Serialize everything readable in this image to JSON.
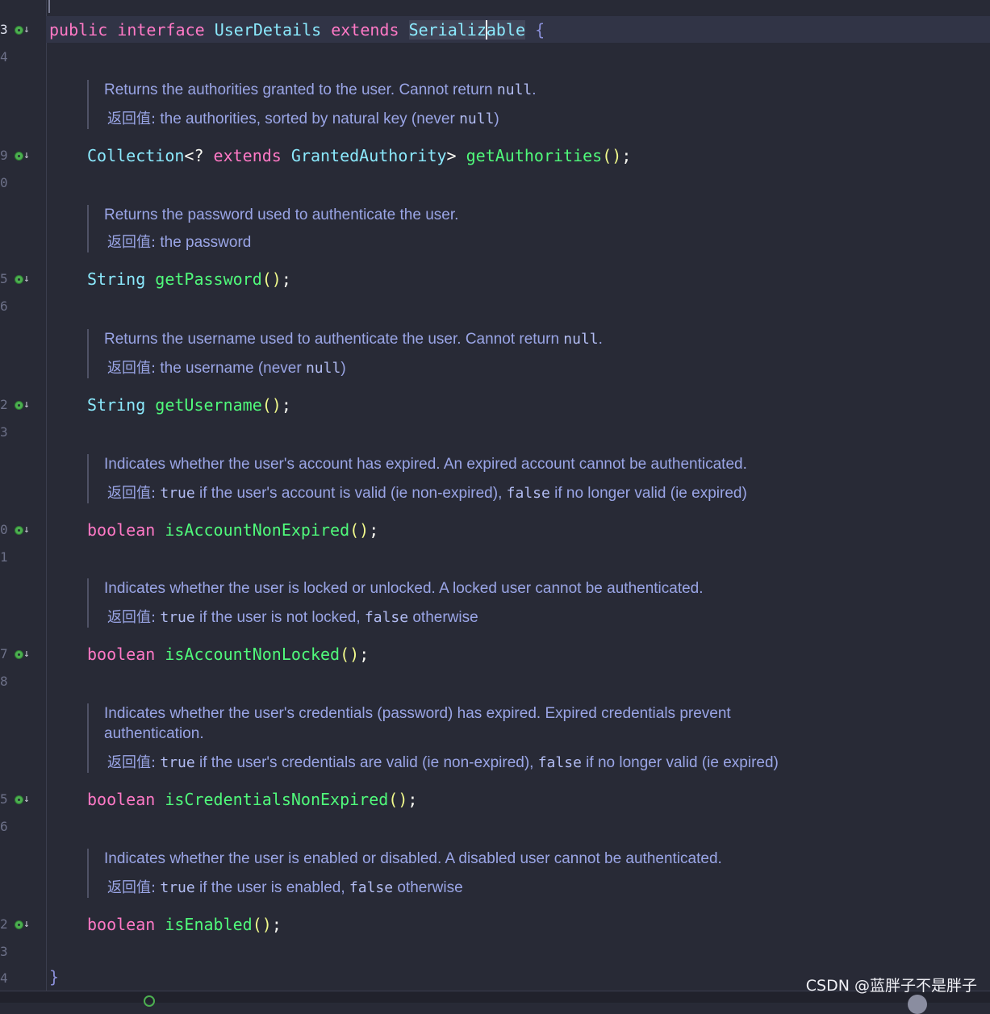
{
  "editor": {
    "header_line": {
      "kw1": "public",
      "kw2": "interface",
      "name": "UserDetails",
      "kw3": "extends",
      "super_a": "Serializ",
      "super_b": "able",
      "brace": "{"
    },
    "closing_brace": "}",
    "line_numbers": {
      "l3": "3",
      "l4": "4",
      "l9": "9",
      "l0": "0",
      "l5": "5",
      "l6": "6",
      "l2": "2",
      "l3b": "3",
      "l0b": "0",
      "l1": "1",
      "l7": "7",
      "l8": "8",
      "l5b": "5",
      "l6b": "6",
      "l2b": "2",
      "l3c": "3",
      "l4b": "4"
    },
    "return_label": "返回值:",
    "null_kw": "null",
    "true_kw": "true",
    "false_kw": "false",
    "methods": [
      {
        "doc_desc_a": "Returns the authorities granted to the user. Cannot return ",
        "doc_desc_b": ".",
        "doc_ret_a": "the authorities, sorted by natural key (never ",
        "doc_ret_b": ")",
        "type_a": "Collection",
        "type_b": "<? ",
        "type_kw": "extends",
        "type_c": "GrantedAuthority",
        "type_d": ">",
        "name": "getAuthorities",
        "parens": "()",
        "semi": ";"
      },
      {
        "doc_desc": "Returns the password used to authenticate the user.",
        "doc_ret": "the password",
        "type": "String",
        "name": "getPassword",
        "parens": "()",
        "semi": ";"
      },
      {
        "doc_desc_a": "Returns the username used to authenticate the user. Cannot return ",
        "doc_desc_b": ".",
        "doc_ret_a": "the username (never ",
        "doc_ret_b": ")",
        "type": "String",
        "name": "getUsername",
        "parens": "()",
        "semi": ";"
      },
      {
        "doc_desc": "Indicates whether the user's account has expired. An expired account cannot be authenticated.",
        "doc_ret_a": " if the user's account is valid (ie non-expired), ",
        "doc_ret_b": " if no longer valid (ie expired)",
        "type": "boolean",
        "name": "isAccountNonExpired",
        "parens": "()",
        "semi": ";"
      },
      {
        "doc_desc": "Indicates whether the user is locked or unlocked. A locked user cannot be authenticated.",
        "doc_ret_a": " if the user is not locked, ",
        "doc_ret_b": " otherwise",
        "type": "boolean",
        "name": "isAccountNonLocked",
        "parens": "()",
        "semi": ";"
      },
      {
        "doc_desc": "Indicates whether the user's credentials (password) has expired. Expired credentials prevent authentication.",
        "doc_ret_a": " if the user's credentials are valid (ie non-expired), ",
        "doc_ret_b": " if no longer valid (ie expired)",
        "type": "boolean",
        "name": "isCredentialsNonExpired",
        "parens": "()",
        "semi": ";"
      },
      {
        "doc_desc": "Indicates whether the user is enabled or disabled. A disabled user cannot be authenticated.",
        "doc_ret_a": " if the user is enabled, ",
        "doc_ret_b": " otherwise",
        "type": "boolean",
        "name": "isEnabled",
        "parens": "()",
        "semi": ";"
      }
    ]
  },
  "watermark": "CSDN @蓝胖子不是胖子",
  "colors": {
    "background": "#282a36",
    "keyword": "#ff79c6",
    "type": "#8be9fd",
    "function": "#50fa7b",
    "doc_text": "#9aa5e6"
  },
  "icons": {
    "implementation_marker": "implemented-down-arrow-icon"
  }
}
